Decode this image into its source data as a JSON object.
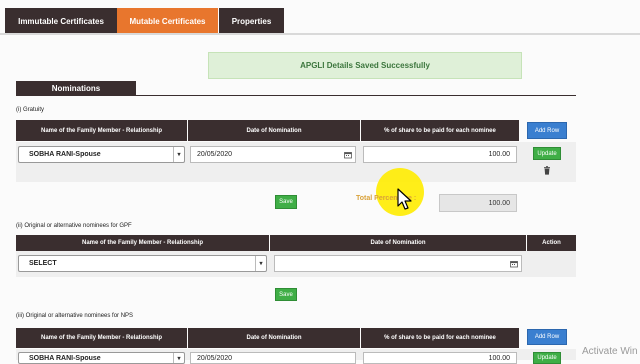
{
  "tabs": [
    {
      "label": "Immutable Certificates",
      "active": false
    },
    {
      "label": "Mutable Certificates",
      "active": true
    },
    {
      "label": "Properties",
      "active": false
    }
  ],
  "alert": {
    "message": "APGLI Details Saved Successfully",
    "color": "#dff0d8"
  },
  "section": {
    "title": "Nominations"
  },
  "gratuity": {
    "label": "(i) Gratuity",
    "headers": [
      "Name of the Family Member - Relationship",
      "Date of Nomination",
      "% of share to be paid for each nominee"
    ],
    "add_row_label": "Add Row",
    "row": {
      "member": "SOBHA RANI-Spouse",
      "date": "20/05/2020",
      "share": "100.00",
      "update_label": "Update",
      "delete_icon": "trash-icon"
    },
    "save_label": "Save",
    "total_label": "Total Percentage :",
    "total_value": "100.00"
  },
  "gpf": {
    "label": "(ii) Original or alternative nominees for GPF",
    "headers": [
      "Name of the Family Member - Relationship",
      "Date of Nomination",
      "Action"
    ],
    "row": {
      "member": "SELECT",
      "date": ""
    },
    "save_label": "Save"
  },
  "nps": {
    "label": "(iii) Original or alternative nominees for NPS",
    "headers": [
      "Name of the Family Member - Relationship",
      "Date of Nomination",
      "% of share to be paid for each nominee"
    ],
    "add_row_label": "Add Row",
    "row": {
      "member": "SOBHA RANI-Spouse",
      "date": "20/05/2020",
      "share": "100.00",
      "update_label": "Update"
    }
  },
  "watermark": "Activate Win",
  "colors": {
    "header_dark": "#3a2e2f",
    "tab_active": "#e8762d",
    "button_blue": "#3a7fd0",
    "button_green": "#3fae46"
  }
}
